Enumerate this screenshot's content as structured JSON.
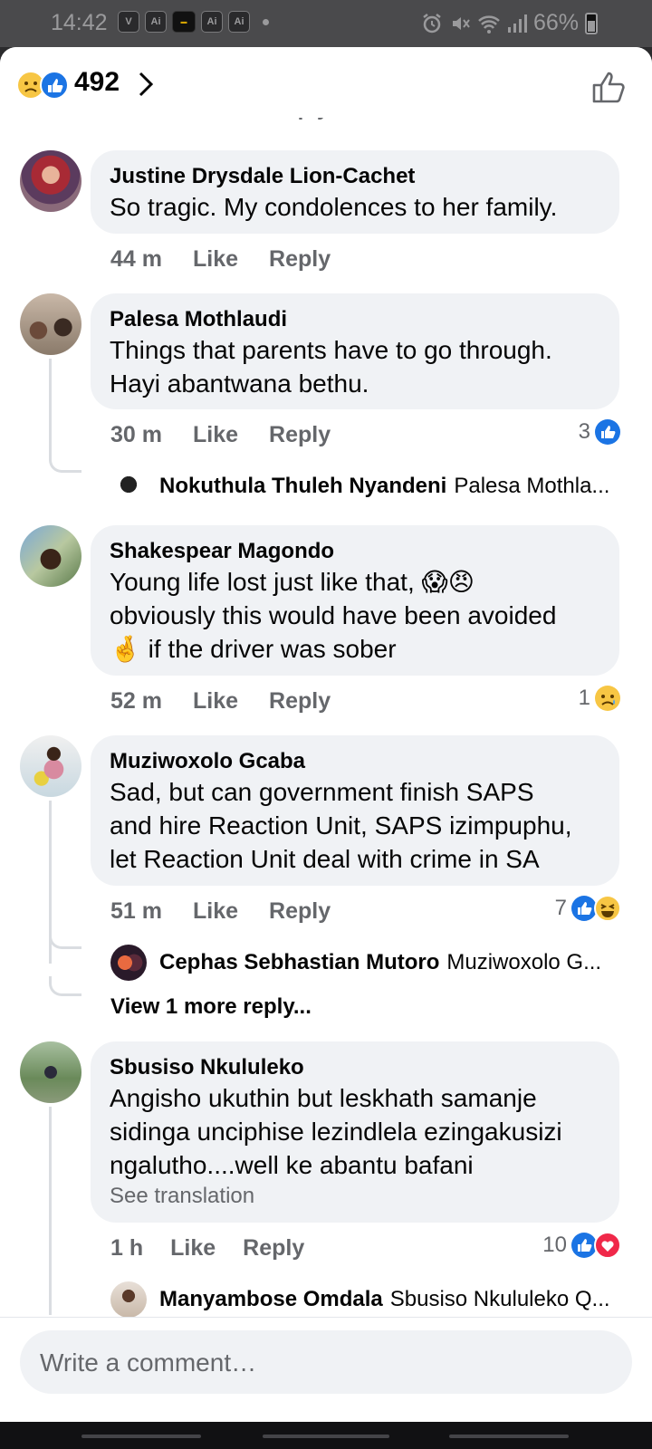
{
  "status_bar": {
    "time": "14:42",
    "apps": [
      "V",
      "Ai",
      "",
      "Ai",
      "Ai"
    ],
    "battery": "66%"
  },
  "header": {
    "reaction_count": "492",
    "reactions": [
      "sad",
      "like"
    ]
  },
  "comments": [
    {
      "author": "Justine Drysdale Lion-Cachet",
      "lines": [
        "So tragic.  My condolences to her family."
      ],
      "time": "44 m",
      "like_label": "Like",
      "reply_label": "Reply",
      "reaction_count": "",
      "reactions": []
    },
    {
      "author": "Palesa Mothlaudi",
      "lines": [
        "Things that parents have to go through.",
        "Hayi abantwana bethu."
      ],
      "time": "30 m",
      "like_label": "Like",
      "reply_label": "Reply",
      "reaction_count": "3",
      "reactions": [
        "like"
      ],
      "replies": [
        {
          "name": "Nokuthula Thuleh Nyandeni",
          "text": "Palesa Mothla..."
        }
      ]
    },
    {
      "author": "Shakespear Magondo",
      "lines": [
        "Young life lost just like that, 😱😠",
        "obviously this would have been avoided",
        "🤞 if the driver was sober"
      ],
      "time": "52 m",
      "like_label": "Like",
      "reply_label": "Reply",
      "reaction_count": "1",
      "reactions": [
        "sad"
      ]
    },
    {
      "author": "Muziwoxolo Gcaba",
      "lines": [
        "Sad, but can government finish SAPS",
        "and hire Reaction Unit, SAPS izimpuphu,",
        "let Reaction Unit deal with crime in SA"
      ],
      "time": "51 m",
      "like_label": "Like",
      "reply_label": "Reply",
      "reaction_count": "7",
      "reactions": [
        "like",
        "haha"
      ],
      "replies": [
        {
          "name": "Cephas Sebhastian Mutoro",
          "text": "Muziwoxolo G..."
        }
      ],
      "view_more": "View 1 more reply..."
    },
    {
      "author": "Sbusiso Nkululeko",
      "lines": [
        "Angisho ukuthin but leskhath samanje",
        "sidinga unciphise lezindlela ezingakusizi",
        "ngalutho....well ke abantu bafani"
      ],
      "see_translation": "See translation",
      "time": "1 h",
      "like_label": "Like",
      "reply_label": "Reply",
      "reaction_count": "10",
      "reactions": [
        "like",
        "love"
      ],
      "replies": [
        {
          "name": "Manyambose Omdala",
          "text": "Sbusiso Nkululeko Q..."
        }
      ]
    }
  ],
  "composer": {
    "placeholder": "Write a comment…"
  },
  "colors": {
    "like_blue": "#1b74e4",
    "bubble_bg": "#f0f2f5",
    "muted_text": "#65676b",
    "love_red": "#f02849"
  }
}
